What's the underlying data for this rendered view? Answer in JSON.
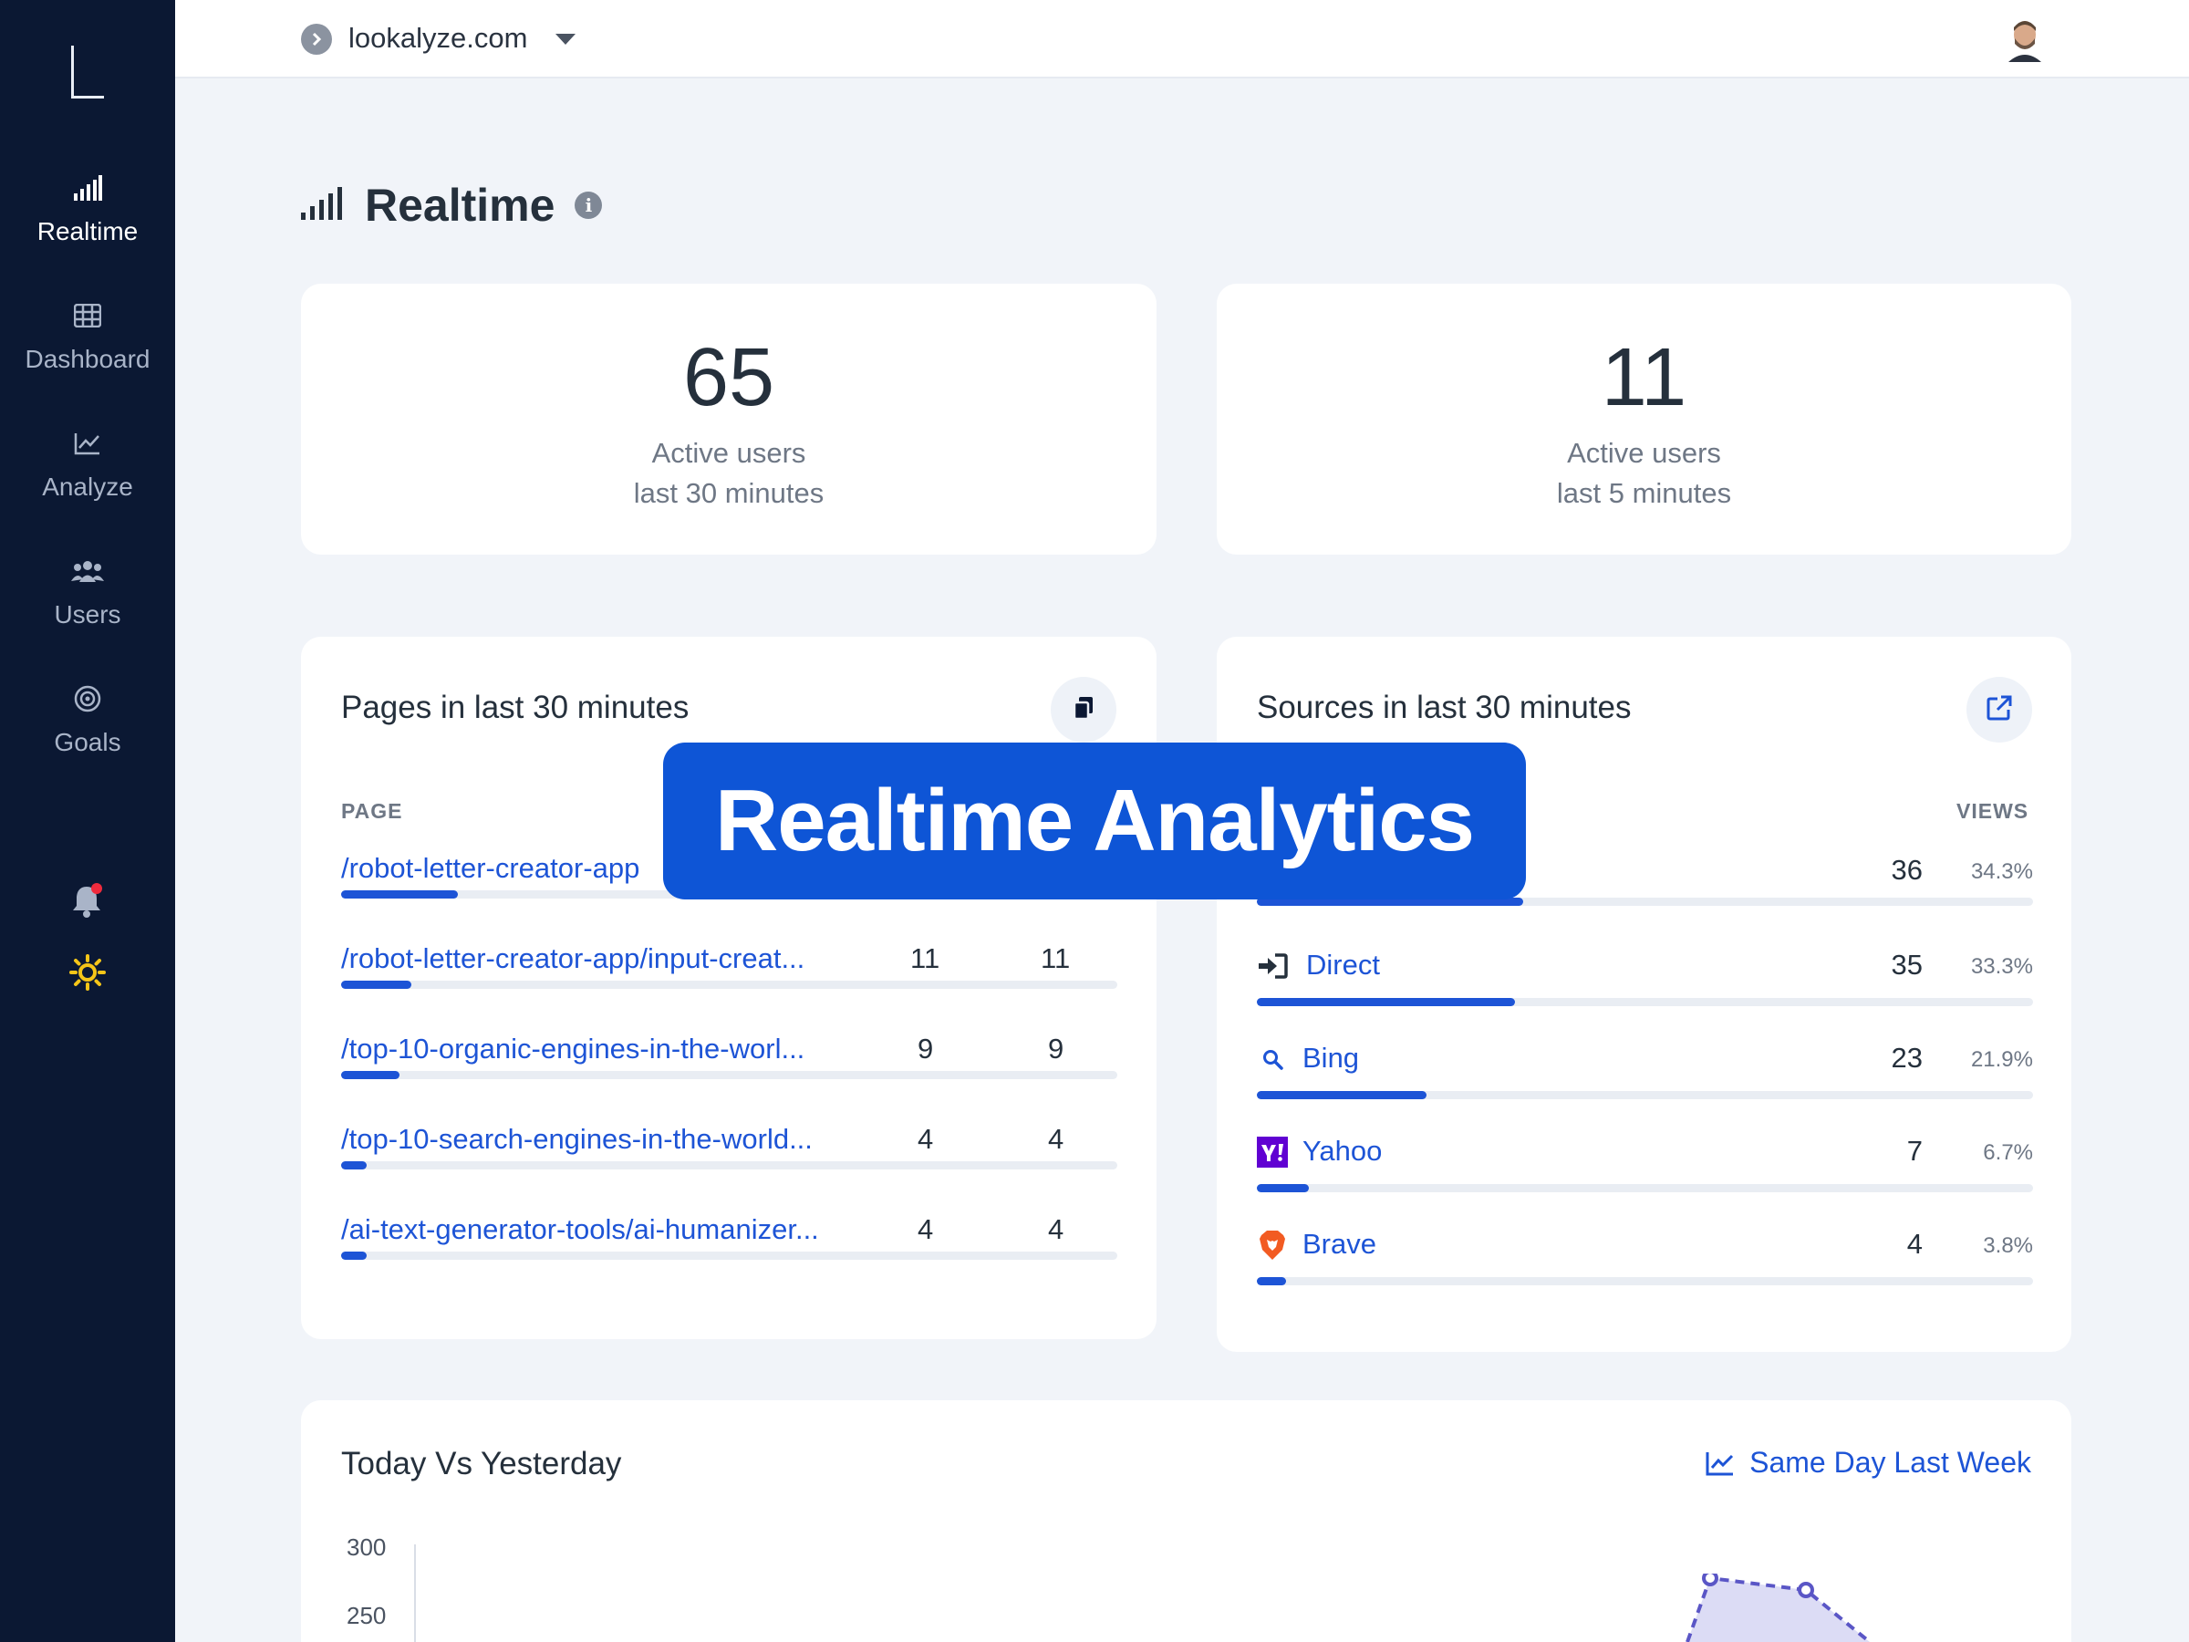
{
  "sidebar": {
    "items": [
      {
        "label": "Realtime",
        "icon": "signal-bars-icon",
        "active": true
      },
      {
        "label": "Dashboard",
        "icon": "grid-icon"
      },
      {
        "label": "Analyze",
        "icon": "line-chart-icon"
      },
      {
        "label": "Users",
        "icon": "users-icon"
      },
      {
        "label": "Goals",
        "icon": "target-icon"
      }
    ],
    "bell_icon": "bell-icon",
    "theme_icon": "sun-icon"
  },
  "topbar": {
    "site": "lookalyze.com",
    "site_icon": "chevron-right-circle-icon",
    "caret_icon": "caret-down-icon",
    "avatar_icon": "user-avatar"
  },
  "page": {
    "title": "Realtime",
    "title_icon": "signal-bars-icon",
    "info_icon": "info-icon"
  },
  "stats": [
    {
      "value": "65",
      "label1": "Active users",
      "label2": "last 30 minutes"
    },
    {
      "value": "11",
      "label1": "Active users",
      "label2": "last 5 minutes"
    }
  ],
  "pages_card": {
    "title": "Pages in last 30 minutes",
    "col_page": "PAGE",
    "action_icon": "copy-icon",
    "rows": [
      {
        "path": "/robot-letter-creator-app",
        "a": "",
        "b": "",
        "fill": 0.15
      },
      {
        "path": "/robot-letter-creator-app/input-creat...",
        "a": "11",
        "b": "11",
        "fill": 0.09
      },
      {
        "path": "/top-10-organic-engines-in-the-worl...",
        "a": "9",
        "b": "9",
        "fill": 0.075
      },
      {
        "path": "/top-10-search-engines-in-the-world...",
        "a": "4",
        "b": "4",
        "fill": 0.033
      },
      {
        "path": "/ai-text-generator-tools/ai-humanizer...",
        "a": "4",
        "b": "4",
        "fill": 0.033
      }
    ]
  },
  "sources_card": {
    "title": "Sources in last 30 minutes",
    "col_views": "VIEWS",
    "action_icon": "external-link-icon",
    "rows": [
      {
        "name": "",
        "icon": "",
        "views": "36",
        "pct": "34.3%",
        "fill": 0.343
      },
      {
        "name": "Direct",
        "icon": "sign-in-icon",
        "views": "35",
        "pct": "33.3%",
        "fill": 0.333
      },
      {
        "name": "Bing",
        "icon": "search-icon",
        "views": "23",
        "pct": "21.9%",
        "fill": 0.219
      },
      {
        "name": "Yahoo",
        "icon": "yahoo-logo-icon",
        "views": "7",
        "pct": "6.7%",
        "fill": 0.067
      },
      {
        "name": "Brave",
        "icon": "brave-logo-icon",
        "views": "4",
        "pct": "3.8%",
        "fill": 0.038
      }
    ]
  },
  "chart_card": {
    "title": "Today Vs Yesterday",
    "link_label": "Same Day Last Week",
    "link_icon": "line-chart-icon",
    "y_ticks": [
      "300",
      "250"
    ]
  },
  "banner": {
    "text": "Realtime Analytics"
  },
  "colors": {
    "sidebar_bg": "#0b1833",
    "accent": "#1d54d6",
    "banner": "#0e55d6",
    "page_bg": "#f1f4f9"
  }
}
